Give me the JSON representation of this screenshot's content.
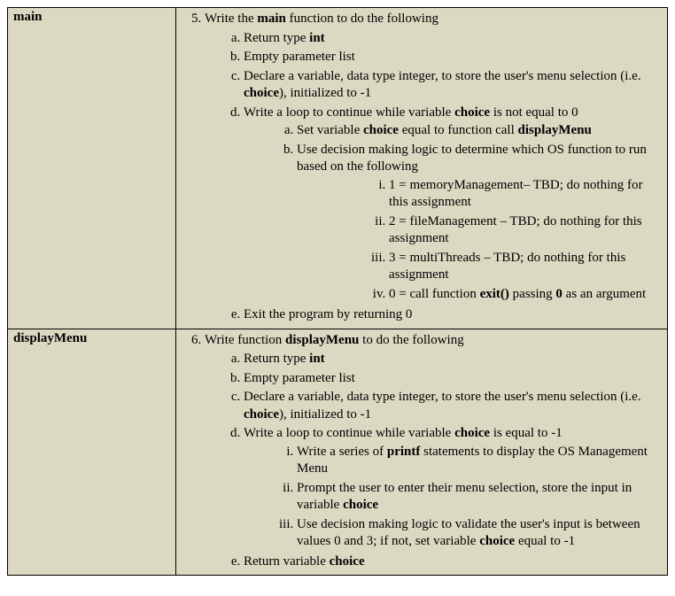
{
  "rows": [
    {
      "label": "main",
      "start": 5,
      "top_text": [
        "Write the ",
        "main",
        " function to do the following"
      ],
      "items": [
        {
          "segments": [
            "Return type ",
            "int"
          ]
        },
        {
          "segments": [
            "Empty parameter list"
          ]
        },
        {
          "segments": [
            "Declare a variable, data type integer, to store the user's menu selection (i.e. ",
            "choice",
            "), initialized to -1"
          ]
        },
        {
          "segments": [
            "Write a loop to continue while variable ",
            "choice",
            " is not equal to 0"
          ],
          "subtype": "alpha",
          "subitems": [
            {
              "segments": [
                "Set variable ",
                "choice",
                " equal to function call ",
                "displayMenu"
              ]
            },
            {
              "segments": [
                "Use decision making logic to determine which OS function to run based on the following"
              ],
              "subtype": "roman",
              "subitems": [
                {
                  "segments": [
                    "1 = memoryManagement– TBD; do nothing for this assignment"
                  ]
                },
                {
                  "segments": [
                    "2 = fileManagement – TBD; do nothing for this assignment"
                  ]
                },
                {
                  "segments": [
                    "3 = multiThreads – TBD; do nothing for this assignment"
                  ]
                },
                {
                  "segments": [
                    "0 = call function ",
                    "exit()",
                    " passing ",
                    "0",
                    " as an argument"
                  ]
                }
              ]
            }
          ]
        },
        {
          "segments": [
            "Exit the program by returning 0"
          ]
        }
      ]
    },
    {
      "label": "displayMenu",
      "start": 6,
      "top_text": [
        "Write function ",
        "displayMenu",
        " to do the following"
      ],
      "items": [
        {
          "segments": [
            "Return type ",
            "int"
          ]
        },
        {
          "segments": [
            "Empty parameter list"
          ]
        },
        {
          "segments": [
            "Declare a variable, data type integer, to store the user's menu selection (i.e. ",
            "choice",
            "), initialized to -1"
          ]
        },
        {
          "segments": [
            "Write a loop to continue while variable ",
            "choice",
            " is equal to -1"
          ],
          "subtype": "roman",
          "subitems": [
            {
              "segments": [
                "Write a series of ",
                "printf",
                " statements to display the OS Management Menu"
              ]
            },
            {
              "segments": [
                "Prompt the user to enter their menu selection, store the input in variable ",
                "choice"
              ]
            },
            {
              "segments": [
                "Use decision making logic to validate the user's input is between values 0 and 3; if not, set variable ",
                "choice",
                " equal to -1"
              ]
            }
          ]
        },
        {
          "segments": [
            "Return variable ",
            "choice"
          ]
        }
      ]
    }
  ],
  "bold_words": [
    "main",
    "int",
    "choice",
    "displayMenu",
    "exit()",
    "0",
    "printf"
  ]
}
